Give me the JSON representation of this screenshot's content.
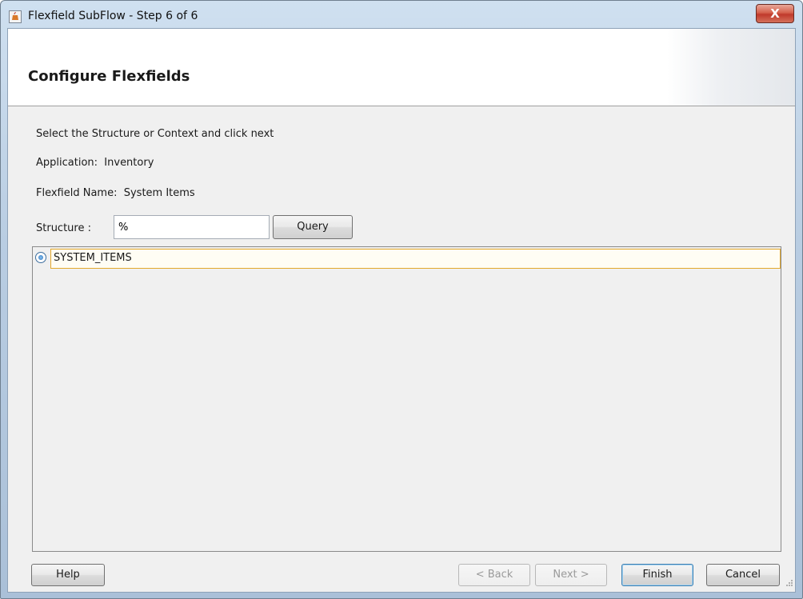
{
  "window": {
    "title": "Flexfield SubFlow - Step 6 of 6",
    "close_label": "X"
  },
  "header": {
    "title": "Configure Flexfields"
  },
  "content": {
    "instruction": "Select the Structure or Context and click next",
    "application_label": "Application:",
    "application_value": "Inventory",
    "flexfield_label": "Flexfield Name:",
    "flexfield_value": "System Items",
    "structure_label": "Structure :",
    "structure_value": "%",
    "query_label": "Query"
  },
  "list": {
    "items": [
      {
        "label": "SYSTEM_ITEMS",
        "selected": true
      }
    ]
  },
  "footer": {
    "help": "Help",
    "back": "< Back",
    "next": "Next >",
    "finish": "Finish",
    "cancel": "Cancel"
  },
  "icons": {
    "app_icon": "java-app-icon",
    "close": "close-icon",
    "radio": "radio-selected-icon",
    "grip": "resize-grip-icon"
  },
  "colors": {
    "selection_border": "#e3a82b",
    "close_button": "#c0392b"
  }
}
